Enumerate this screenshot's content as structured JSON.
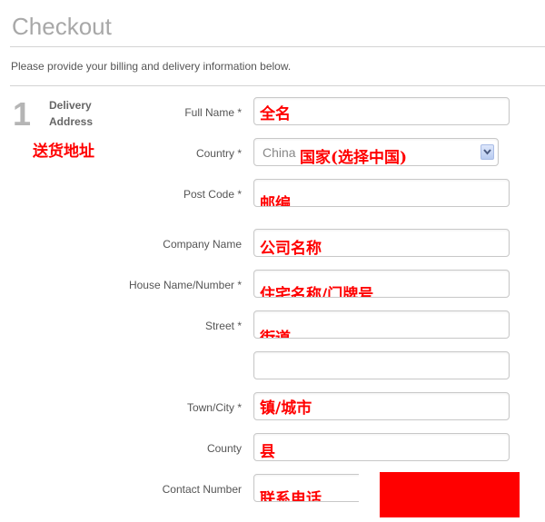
{
  "page": {
    "title": "Checkout",
    "intro": "Please provide your billing and delivery information below."
  },
  "step": {
    "number": "1",
    "label_line1": "Delivery",
    "label_line2": "Address",
    "annotation": "送货地址"
  },
  "fields": {
    "full_name": {
      "label": "Full Name *",
      "annotation": "全名"
    },
    "country": {
      "label": "Country *",
      "value": "China",
      "annotation": "国家(选择中国)"
    },
    "post_code": {
      "label": "Post Code *",
      "annotation": "邮编"
    },
    "company_name": {
      "label": "Company Name",
      "annotation": "公司名称"
    },
    "house": {
      "label": "House Name/Number *",
      "annotation": "住宅名称/门牌号"
    },
    "street": {
      "label": "Street *",
      "annotation": "街道"
    },
    "street2": {
      "label": ""
    },
    "town": {
      "label": "Town/City *",
      "annotation": "镇/城市"
    },
    "county": {
      "label": "County",
      "annotation": "县"
    },
    "contact": {
      "label": "Contact Number",
      "annotation": "联系电话"
    }
  },
  "colors": {
    "annotation": "#ff0000",
    "redaction": "#ff0000"
  }
}
